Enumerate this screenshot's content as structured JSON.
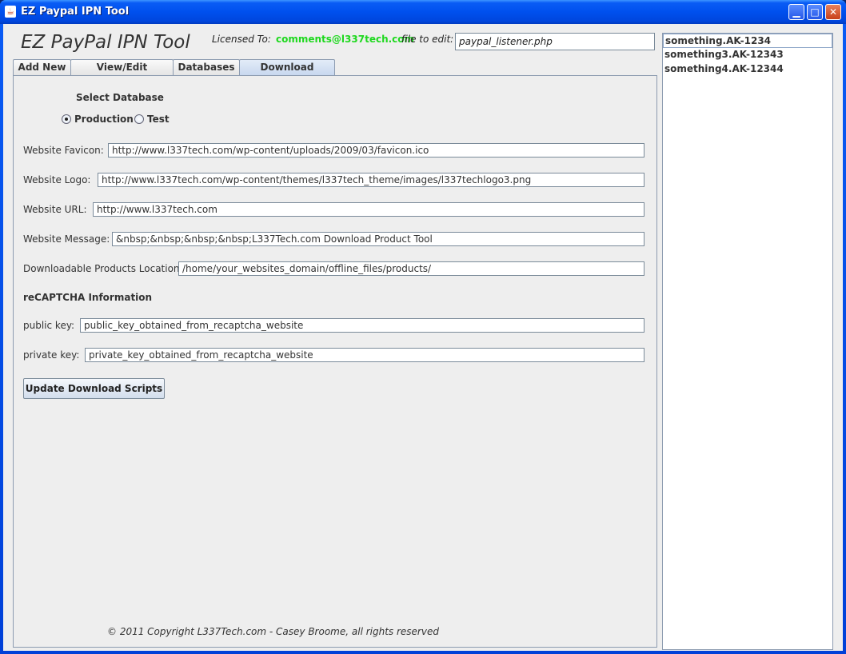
{
  "window": {
    "title": "EZ Paypal IPN Tool",
    "icon": "java-coffee-icon",
    "controls": {
      "minimize": "minimize-icon",
      "maximize": "maximize-icon",
      "close": "close-icon"
    }
  },
  "header": {
    "app_title": "EZ PayPal IPN Tool",
    "licensed_label": "Licensed To:",
    "licensed_email": "comments@l337tech.com",
    "file_label": "file to edit:",
    "file_value": "paypal_listener.php"
  },
  "tabs": [
    {
      "label": "Add New"
    },
    {
      "label": "View/Edit Exsisting"
    },
    {
      "label": "Databases"
    },
    {
      "label": "Download Scripts"
    }
  ],
  "active_tab": "Download Scripts",
  "form": {
    "select_db_title": "Select Database",
    "db_options": [
      {
        "label": "Production",
        "selected": true
      },
      {
        "label": "Test",
        "selected": false
      }
    ],
    "favicon_label": "Website Favicon:",
    "favicon_value": "http://www.l337tech.com/wp-content/uploads/2009/03/favicon.ico",
    "logo_label": "Website Logo:",
    "logo_value": "http://www.l337tech.com/wp-content/themes/l337tech_theme/images/l337techlogo3.png",
    "url_label": "Website URL:",
    "url_value": "http://www.l337tech.com",
    "message_label": "Website Message:",
    "message_value": "&nbsp;&nbsp;&nbsp;&nbsp;L337Tech.com Download Product Tool",
    "location_label": "Downloadable Products Location:",
    "location_value": "/home/your_websites_domain/offline_files/products/",
    "recaptcha_title": "reCAPTCHA Information",
    "public_key_label": "public key:",
    "public_key_value": "public_key_obtained_from_recaptcha_website",
    "private_key_label": "private key:",
    "private_key_value": "private_key_obtained_from_recaptcha_website",
    "update_button": "Update Download Scripts"
  },
  "footer": {
    "copyright": "© 2011 Copyright L337Tech.com - Casey Broome, all rights reserved"
  },
  "sidebar_list": {
    "items": [
      "something.AK-1234",
      "something3.AK-12343",
      "something4.AK-12344"
    ],
    "selected_index": 0
  },
  "colors": {
    "email_green": "#1ed81e",
    "titlebar_blue": "#0050ee",
    "active_tab": "#c6d6ee"
  }
}
